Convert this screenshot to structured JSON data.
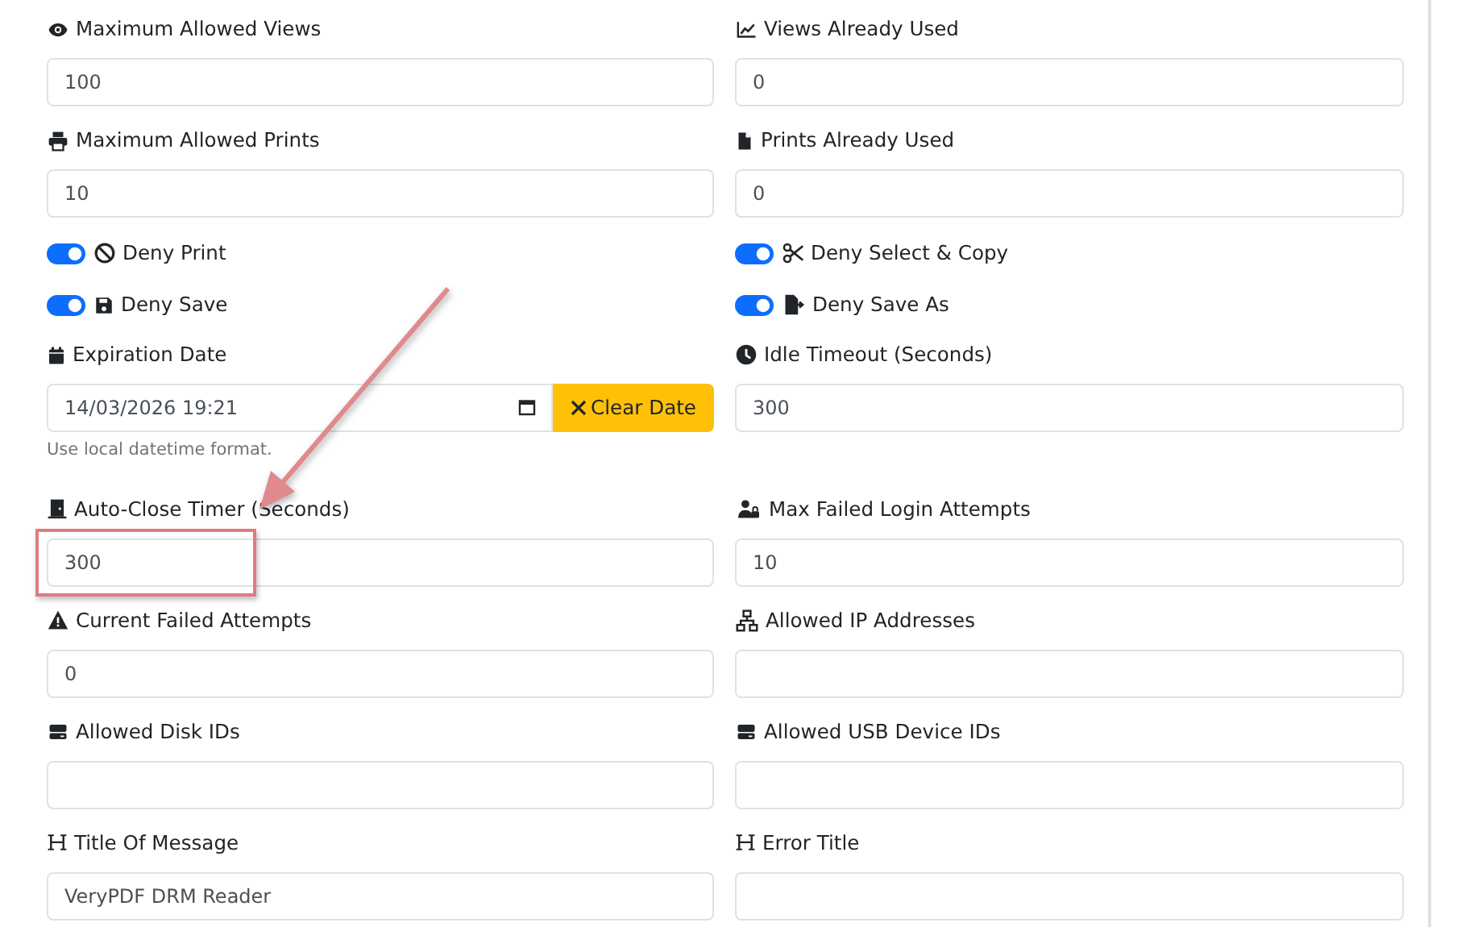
{
  "fields": [
    {
      "kind": "input",
      "label": "Maximum Allowed Views",
      "value": "100"
    },
    {
      "kind": "input",
      "label": "Views Already Used",
      "value": "0"
    },
    {
      "kind": "input",
      "label": "Maximum Allowed Prints",
      "value": "10"
    },
    {
      "kind": "input",
      "label": "Prints Already Used",
      "value": "0"
    },
    {
      "kind": "switch",
      "label": "Deny Print",
      "on": true
    },
    {
      "kind": "switch",
      "label": "Deny Select & Copy",
      "on": true
    },
    {
      "kind": "switch",
      "label": "Deny Save",
      "on": true
    },
    {
      "kind": "switch",
      "label": "Deny Save As",
      "on": true
    },
    {
      "kind": "date",
      "label": "Expiration Date",
      "value": "14/03/2026 19:21",
      "button": "Clear Date",
      "help": "Use local datetime format."
    },
    {
      "kind": "input",
      "label": "Idle Timeout (Seconds)",
      "value": "300"
    },
    {
      "kind": "input",
      "label": "Auto-Close Timer (Seconds)",
      "value": "300",
      "highlighted": true
    },
    {
      "kind": "input",
      "label": "Max Failed Login Attempts",
      "value": "10"
    },
    {
      "kind": "input",
      "label": "Current Failed Attempts",
      "value": "0"
    },
    {
      "kind": "input",
      "label": "Allowed IP Addresses"
    },
    {
      "kind": "input",
      "label": "Allowed Disk IDs"
    },
    {
      "kind": "input",
      "label": "Allowed USB Device IDs"
    },
    {
      "kind": "input",
      "label": "Title Of Message",
      "value": "VeryPDF DRM Reader"
    },
    {
      "kind": "input",
      "label": "Error Title"
    }
  ]
}
